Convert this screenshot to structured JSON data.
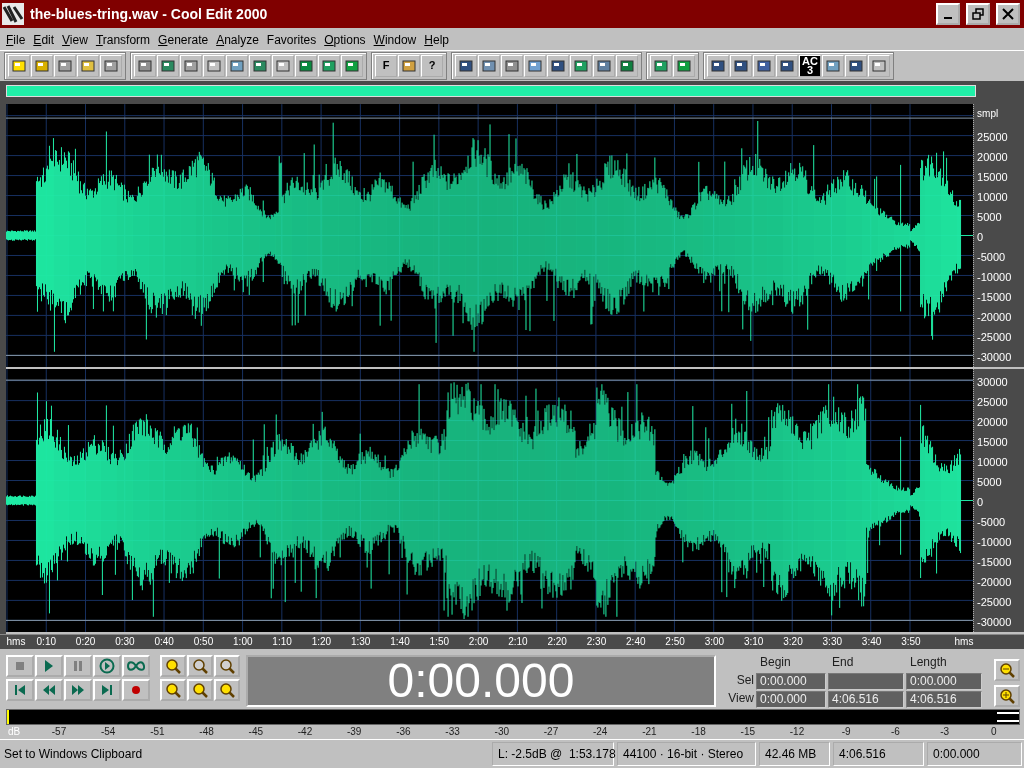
{
  "window": {
    "title": "the-blues-tring.wav - Cool Edit 2000"
  },
  "menu": [
    {
      "label": "File",
      "underlined": true
    },
    {
      "label": "Edit",
      "underlined": true
    },
    {
      "label": "View",
      "underlined": true
    },
    {
      "label": "Transform",
      "underlined": true
    },
    {
      "label": "Generate",
      "underlined": true
    },
    {
      "label": "Analyze",
      "underlined": true
    },
    {
      "label": "Favorites",
      "underlined": false
    },
    {
      "label": "Options",
      "underlined": true
    },
    {
      "label": "Window",
      "underlined": true
    },
    {
      "label": "Help",
      "underlined": true
    }
  ],
  "toolbar_text_buttons": [
    {
      "label": "F"
    },
    {
      "label": "?"
    },
    {
      "label": "AC",
      "sub": "3"
    }
  ],
  "channels": [
    {
      "unit": "smpl",
      "axis_labels": [
        "25000",
        "20000",
        "15000",
        "10000",
        "5000",
        "0",
        "-5000",
        "-10000",
        "-15000",
        "-20000",
        "-25000",
        "-30000"
      ]
    },
    {
      "axis_labels": [
        "30000",
        "25000",
        "20000",
        "15000",
        "10000",
        "5000",
        "0",
        "-5000",
        "-10000",
        "-15000",
        "-20000",
        "-25000",
        "-30000"
      ]
    }
  ],
  "time_ruler": {
    "unit_left": "hms",
    "labels": [
      "0:10",
      "0:20",
      "0:30",
      "0:40",
      "0:50",
      "1:00",
      "1:10",
      "1:20",
      "1:30",
      "1:40",
      "1:50",
      "2:00",
      "2:10",
      "2:20",
      "2:30",
      "2:40",
      "2:50",
      "3:00",
      "3:10",
      "3:20",
      "3:30",
      "3:40",
      "3:50"
    ],
    "unit_right": "hms"
  },
  "time_display": "0:00.000",
  "selection": {
    "headers": [
      "Begin",
      "End",
      "Length"
    ],
    "rows": [
      {
        "label": "Sel",
        "begin": "0:00.000",
        "end": "",
        "length": "0:00.000"
      },
      {
        "label": "View",
        "begin": "0:00.000",
        "end": "4:06.516",
        "length": "4:06.516"
      }
    ]
  },
  "db_scale": {
    "unit": "dB",
    "labels": [
      "-57",
      "-54",
      "-51",
      "-48",
      "-45",
      "-42",
      "-39",
      "-36",
      "-33",
      "-30",
      "-27",
      "-24",
      "-21",
      "-18",
      "-15",
      "-12",
      "-9",
      "-6",
      "-3",
      "0"
    ]
  },
  "status_bar": {
    "message": "Set to Windows Clipboard",
    "cursor_level": "L: -2.5dB @  1:53.178",
    "format": "44100 · 16-bit · Stereo",
    "size": "42.46 MB",
    "length": "4:06.516",
    "position": "0:00.000"
  }
}
